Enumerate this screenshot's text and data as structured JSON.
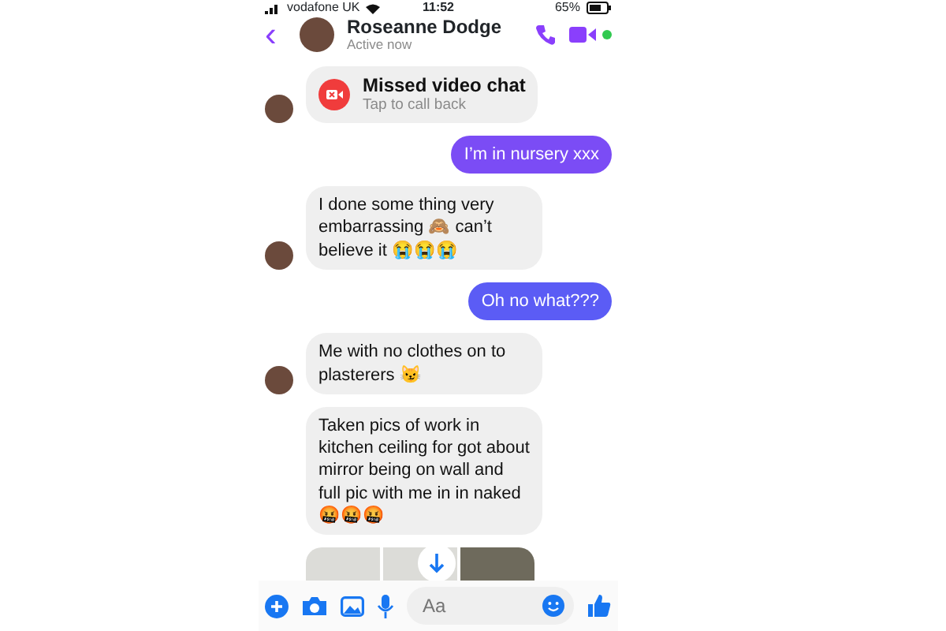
{
  "status_bar": {
    "carrier": "vodafone UK",
    "time": "11:52",
    "battery": "65%"
  },
  "header": {
    "back": "‹",
    "name": "Roseanne Dodge",
    "presence": "Active now",
    "online": true
  },
  "messages": [
    {
      "kind": "call",
      "title": "Missed video chat",
      "subtitle": "Tap to call back",
      "sent": false,
      "avatar": true
    },
    {
      "kind": "text",
      "text": "I’m in nursery xxx",
      "sent": true
    },
    {
      "kind": "text",
      "text": "I done some thing very embarrassing 🙈 can’t believe it 😭😭😭",
      "sent": false,
      "avatar": true
    },
    {
      "kind": "text",
      "text": "Oh no what???",
      "sent": true
    },
    {
      "kind": "text",
      "text": "Me with no clothes on to plasterers 😼",
      "sent": false,
      "avatar": true
    },
    {
      "kind": "text",
      "text": "Taken pics of work in kitchen ceiling for got about mirror being on wall and full pic with me in in naked 🤬🤬🤬",
      "sent": false,
      "avatar": false
    },
    {
      "kind": "photos"
    }
  ],
  "composer": {
    "placeholder": "Aa"
  }
}
